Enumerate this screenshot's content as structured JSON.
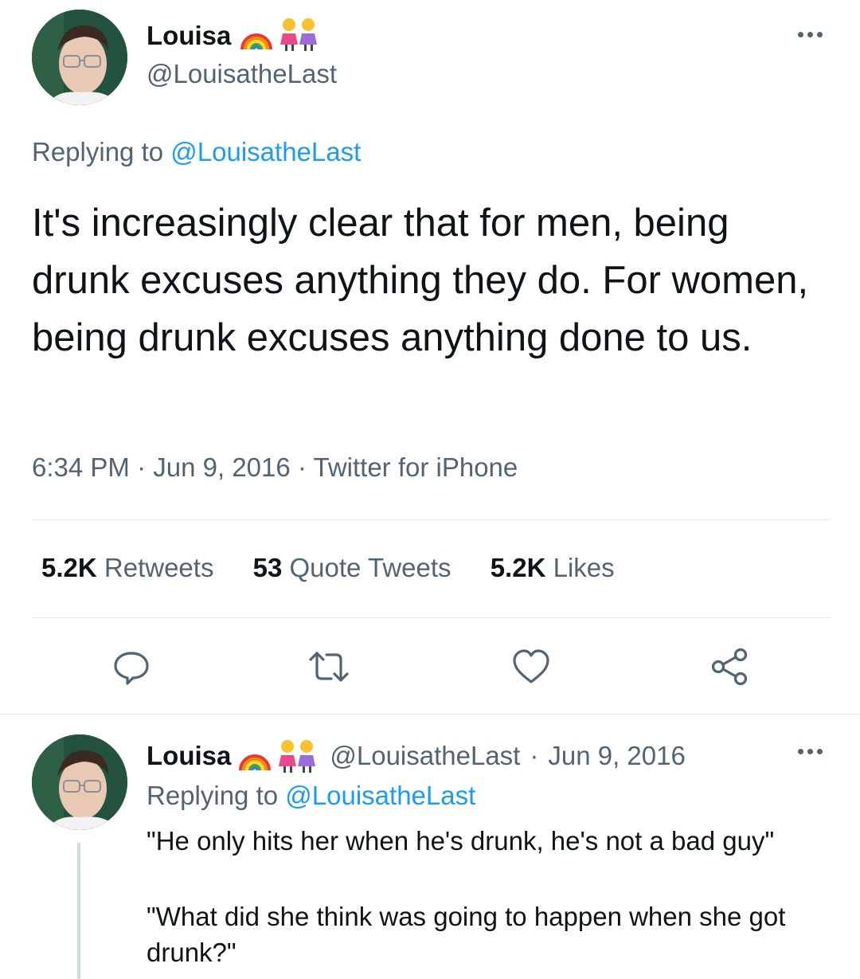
{
  "tweet": {
    "author": {
      "name": "Louisa",
      "handle": "@LouisatheLast",
      "name_emojis": [
        "rainbow-emoji",
        "two-women-emoji"
      ]
    },
    "replying_label": "Replying to",
    "replying_handle": "@LouisatheLast",
    "text": "It's increasingly clear that for men, being drunk excuses anything they do. For women, being drunk excuses anything done to us.",
    "meta": {
      "time": "6:34 PM",
      "date": "Jun 9, 2016",
      "source": "Twitter for iPhone",
      "sep": "·"
    },
    "stats": [
      {
        "count": "5.2K",
        "label": "Retweets"
      },
      {
        "count": "53",
        "label": "Quote Tweets"
      },
      {
        "count": "5.2K",
        "label": "Likes"
      }
    ],
    "actions": [
      "reply-icon",
      "retweet-icon",
      "like-icon",
      "share-icon"
    ]
  },
  "reply": {
    "author": {
      "name": "Louisa",
      "handle": "@LouisatheLast",
      "name_emojis": [
        "rainbow-emoji",
        "two-women-emoji"
      ]
    },
    "sep": "·",
    "date": "Jun 9, 2016",
    "replying_label": "Replying to",
    "replying_handle": "@LouisatheLast",
    "line1": "\"He only hits her when he's drunk, he's not a bad guy\"",
    "line2": "\"What did she think was going to happen when she got drunk?\""
  },
  "colors": {
    "text": "#0f1419",
    "muted": "#536471",
    "link": "#1d9bf0",
    "divider": "#e6e9ec",
    "icon": "#536471"
  }
}
